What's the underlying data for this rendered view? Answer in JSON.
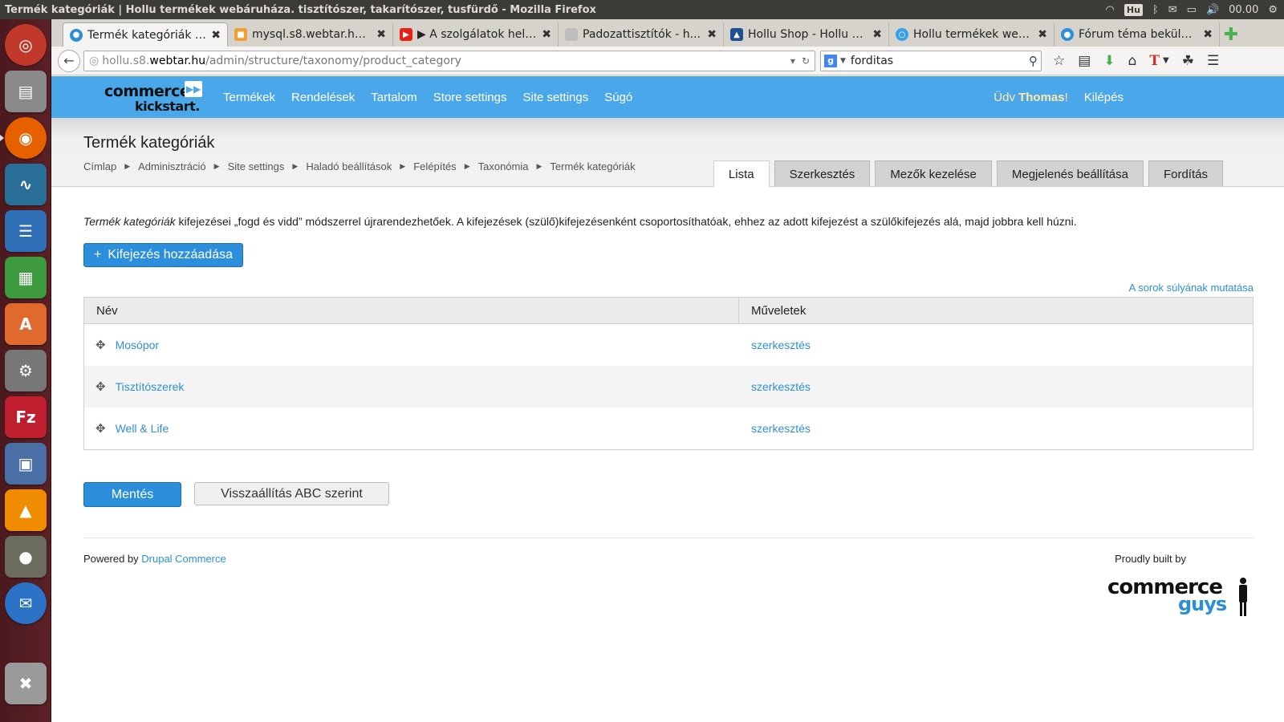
{
  "os": {
    "window_title": "Termék kategóriák | Hollu termékek webáruháza. tisztítószer, takarítószer, tusfürdő - Mozilla Firefox",
    "keyboard": "Hu",
    "clock": "00.00"
  },
  "browser": {
    "tabs": [
      {
        "label": "Termék kategóriák |...",
        "active": true
      },
      {
        "label": "mysql.s8.webtar.hu ...",
        "active": false
      },
      {
        "label": "▶ A szolgálatok hely...",
        "active": false
      },
      {
        "label": "Padozattisztítók - h...",
        "active": false
      },
      {
        "label": "Hollu Shop - Hollu Sh...",
        "active": false
      },
      {
        "label": "Hollu termékek web...",
        "active": false
      },
      {
        "label": "Fórum téma beküld...",
        "active": false
      }
    ],
    "url_prefix": "hollu.s8.",
    "url_domain": "webtar.hu",
    "url_path": "/admin/structure/taxonomy/product_category",
    "search_value": "forditas"
  },
  "site": {
    "logo_line1": "commerce",
    "logo_line2": "kickstart.",
    "menu": [
      "Termékek",
      "Rendelések",
      "Tartalom",
      "Store settings",
      "Site settings",
      "Súgó"
    ],
    "greeting_prefix": "Üdv ",
    "user_name": "Thomas",
    "greeting_suffix": "!",
    "logout": "Kilépés"
  },
  "page": {
    "title": "Termék kategóriák",
    "breadcrumb": [
      "Címlap",
      "Adminisztráció",
      "Site settings",
      "Haladó beállítások",
      "Felépítés",
      "Taxonómia",
      "Termék kategóriák"
    ],
    "tabs": [
      {
        "label": "Lista",
        "active": true
      },
      {
        "label": "Szerkesztés",
        "active": false
      },
      {
        "label": "Mezők kezelése",
        "active": false
      },
      {
        "label": "Megjelenés beállítása",
        "active": false
      },
      {
        "label": "Fordítás",
        "active": false
      }
    ],
    "help_em": "Termék kategóriák",
    "help_rest": " kifejezései „fogd és vidd” módszerrel újrarendezhetőek. A kifejezések (szülő)kifejezésenként csoportosíthatóak, ehhez az adott kifejezést a szülőkifejezés alá, majd jobbra kell húzni.",
    "add_button": "Kifejezés hozzáadása",
    "weights_link": "A sorok súlyának mutatása",
    "table": {
      "headers": [
        "Név",
        "Műveletek"
      ],
      "rows": [
        {
          "name": "Mosópor",
          "op": "szerkesztés"
        },
        {
          "name": "Tisztítószerek",
          "op": "szerkesztés"
        },
        {
          "name": "Well & Life",
          "op": "szerkesztés"
        }
      ]
    },
    "save_button": "Mentés",
    "reset_button": "Visszaállítás ABC szerint"
  },
  "footer": {
    "powered_prefix": "Powered by ",
    "powered_link": "Drupal Commerce",
    "built_by": "Proudly built by",
    "guys_line1": "commerce",
    "guys_line2": "guys"
  }
}
